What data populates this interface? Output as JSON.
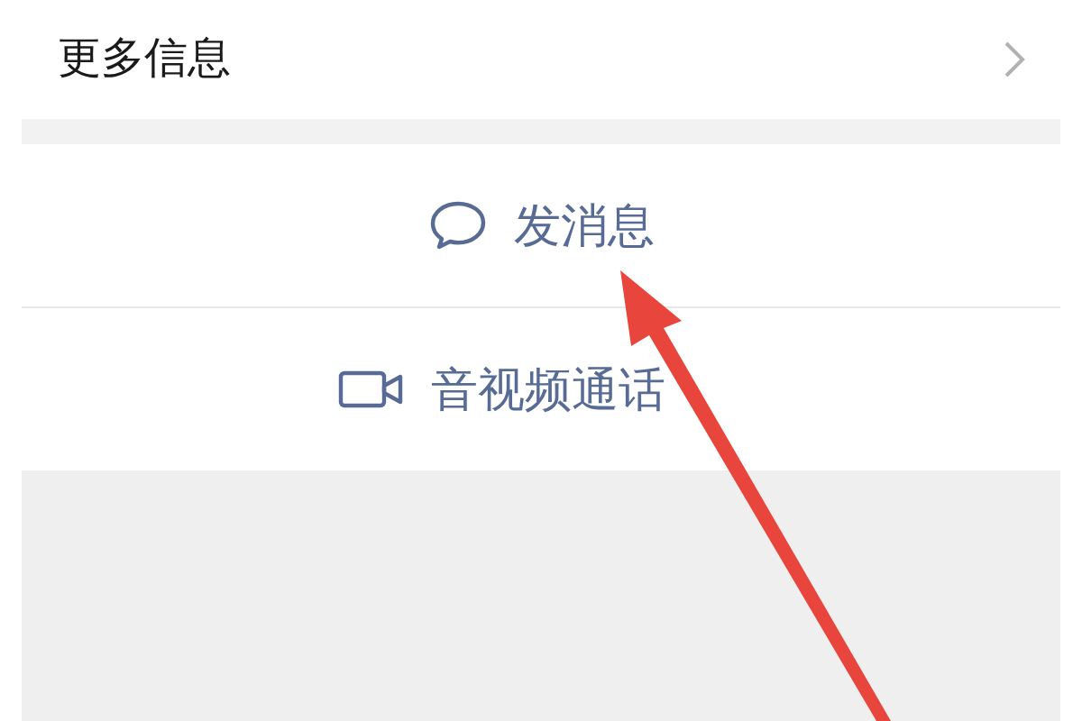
{
  "info_row": {
    "label": "更多信息"
  },
  "actions": [
    {
      "kind": "message",
      "label": "发消息"
    },
    {
      "kind": "call",
      "label": "音视频通话"
    }
  ]
}
